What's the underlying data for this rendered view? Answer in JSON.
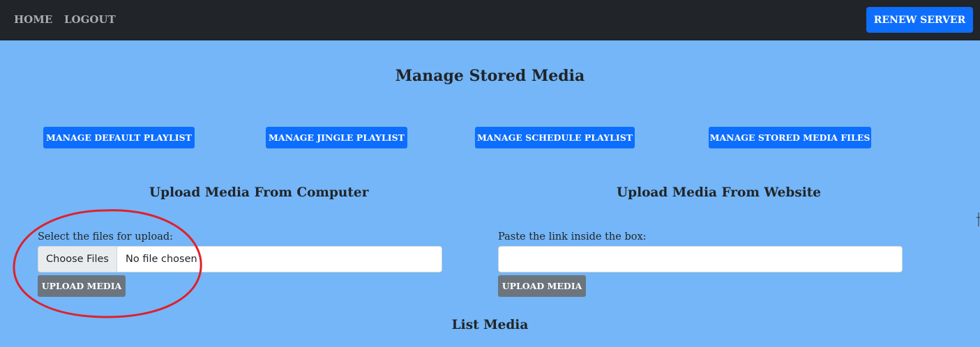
{
  "navbar": {
    "home_label": "HOME",
    "logout_label": "LOGOUT",
    "renew_label": "RENEW SERVER"
  },
  "page": {
    "title": "Manage Stored Media"
  },
  "playlist_buttons": [
    {
      "label": "MANAGE DEFAULT PLAYLIST"
    },
    {
      "label": "MANAGE JINGLE PLAYLIST"
    },
    {
      "label": "MANAGE SCHEDULE PLAYLIST"
    },
    {
      "label": "MANAGE STORED MEDIA FILES"
    }
  ],
  "upload_computer": {
    "title": "Upload Media From Computer",
    "field_label": "Select the files for upload:",
    "choose_label": "Choose Files",
    "file_status": "No file chosen",
    "button_label": "UPLOAD MEDIA"
  },
  "upload_website": {
    "title": "Upload Media From Website",
    "field_label": "Paste the link inside the box:",
    "url_value": "",
    "button_label": "UPLOAD MEDIA"
  },
  "list_media": {
    "title": "List Media"
  },
  "colors": {
    "background": "#74b6f7",
    "navbar": "#212529",
    "primary": "#0d6efd",
    "secondary": "#6c757d",
    "annotation": "#e0202a"
  }
}
